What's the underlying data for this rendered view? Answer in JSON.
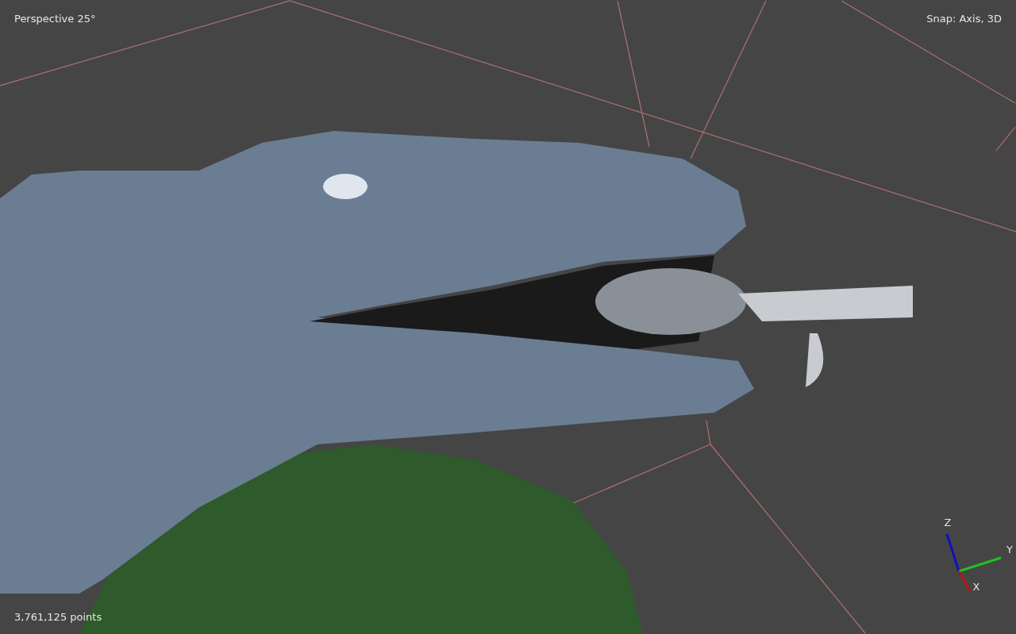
{
  "viewport": {
    "projection_label": "Perspective 25°",
    "snap_label": "Snap: Axis, 3D",
    "point_count": "3,761,125 points"
  },
  "axis_gizmo": {
    "axes": [
      {
        "label": "Z",
        "color": "#1010c0"
      },
      {
        "label": "Y",
        "color": "#20c020"
      },
      {
        "label": "X",
        "color": "#b01818"
      }
    ]
  }
}
